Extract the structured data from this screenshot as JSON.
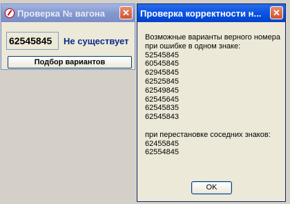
{
  "main_window": {
    "title": "Проверка № вагона",
    "number": "62545845",
    "status": "Не существует",
    "variants_button": "Подбор вариантов"
  },
  "dialog": {
    "title": "Проверка корректности н...",
    "intro": "Возможные варианты верного номера\nпри ошибке в одном знаке:",
    "single_error_variants": [
      "52545845",
      "60545845",
      "62945845",
      "62525845",
      "62549845",
      "62545645",
      "62545835",
      "62545843"
    ],
    "swap_heading": "при перестановке соседних знаков:",
    "swap_variants": [
      "62455845",
      "62554845"
    ],
    "ok_label": "OK"
  },
  "icons": {
    "close": "close-icon",
    "app": "app-icon"
  },
  "colors": {
    "title_active": "#0a54e3",
    "title_inactive": "#8497cf",
    "status_text": "#0a2a8a"
  }
}
